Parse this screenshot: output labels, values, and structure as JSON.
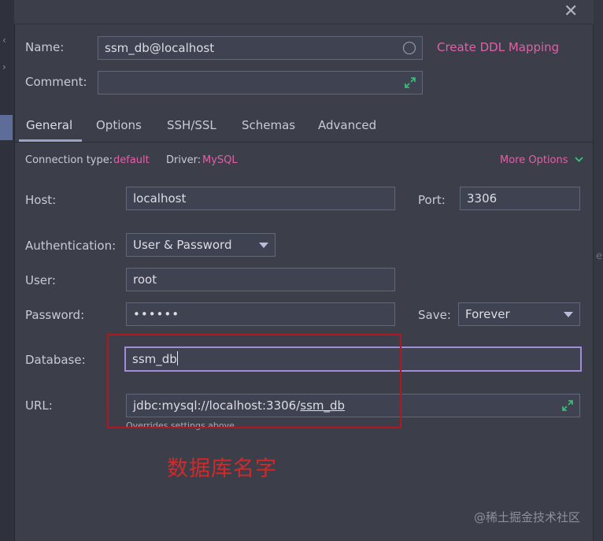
{
  "dialog": {
    "close_icon": "close-icon"
  },
  "name_row": {
    "label": "Name:",
    "value": "ssm_db@localhost",
    "link": "Create DDL Mapping"
  },
  "comment_row": {
    "label": "Comment:",
    "value": ""
  },
  "tabs": [
    {
      "label": "General",
      "active": true
    },
    {
      "label": "Options",
      "active": false
    },
    {
      "label": "SSH/SSL",
      "active": false
    },
    {
      "label": "Schemas",
      "active": false
    },
    {
      "label": "Advanced",
      "active": false
    }
  ],
  "connection": {
    "type_label": "Connection type:",
    "type_value": "default",
    "driver_label": "Driver:",
    "driver_value": "MySQL",
    "more_options": "More Options"
  },
  "host": {
    "label": "Host:",
    "value": "localhost"
  },
  "port": {
    "label": "Port:",
    "value": "3306"
  },
  "auth": {
    "label": "Authentication:",
    "value": "User & Password"
  },
  "user": {
    "label": "User:",
    "value": "root"
  },
  "password": {
    "label": "Password:",
    "value": "••••••"
  },
  "save": {
    "label": "Save:",
    "value": "Forever"
  },
  "database": {
    "label": "Database:",
    "value": "ssm_db"
  },
  "url": {
    "label": "URL:",
    "prefix": "jdbc:mysql://localhost:3306/",
    "db": "ssm_db",
    "hint": "Overrides settings above"
  },
  "annotation": "数据库名字",
  "watermark": "@稀土掘金技术社区",
  "colors": {
    "link": "#e060a8",
    "annotation": "#d02a2a",
    "focus": "#a28bd8",
    "panel": "#3c3f4a"
  }
}
